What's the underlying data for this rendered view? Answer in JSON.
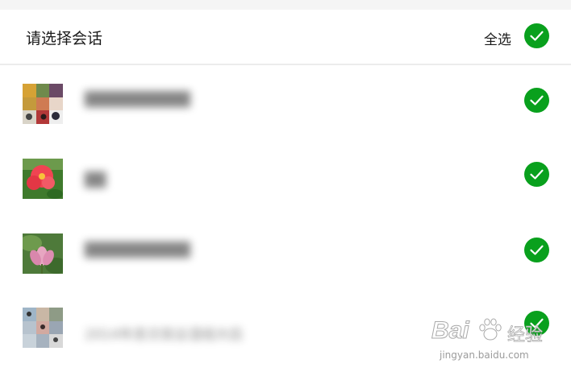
{
  "header": {
    "title": "请选择会话",
    "select_all_label": "全选",
    "select_all_checked": true
  },
  "conversations": [
    {
      "name": "██████████",
      "selected": true,
      "avatar": "group-collage-avatar"
    },
    {
      "name": "██",
      "selected": true,
      "avatar": "red-flower-avatar"
    },
    {
      "name": "██████████",
      "selected": true,
      "avatar": "lotus-flower-avatar"
    },
    {
      "name": "2014年息文就业湿组大后",
      "selected": true,
      "avatar": "group-photo-collage-avatar"
    }
  ],
  "watermark": {
    "brand": "Bai",
    "brand_suffix": "经验",
    "url": "jingyan.baidu.com"
  },
  "colors": {
    "check_green": "#09a01d",
    "header_bg": "#ffffff",
    "divider": "#ececec"
  }
}
